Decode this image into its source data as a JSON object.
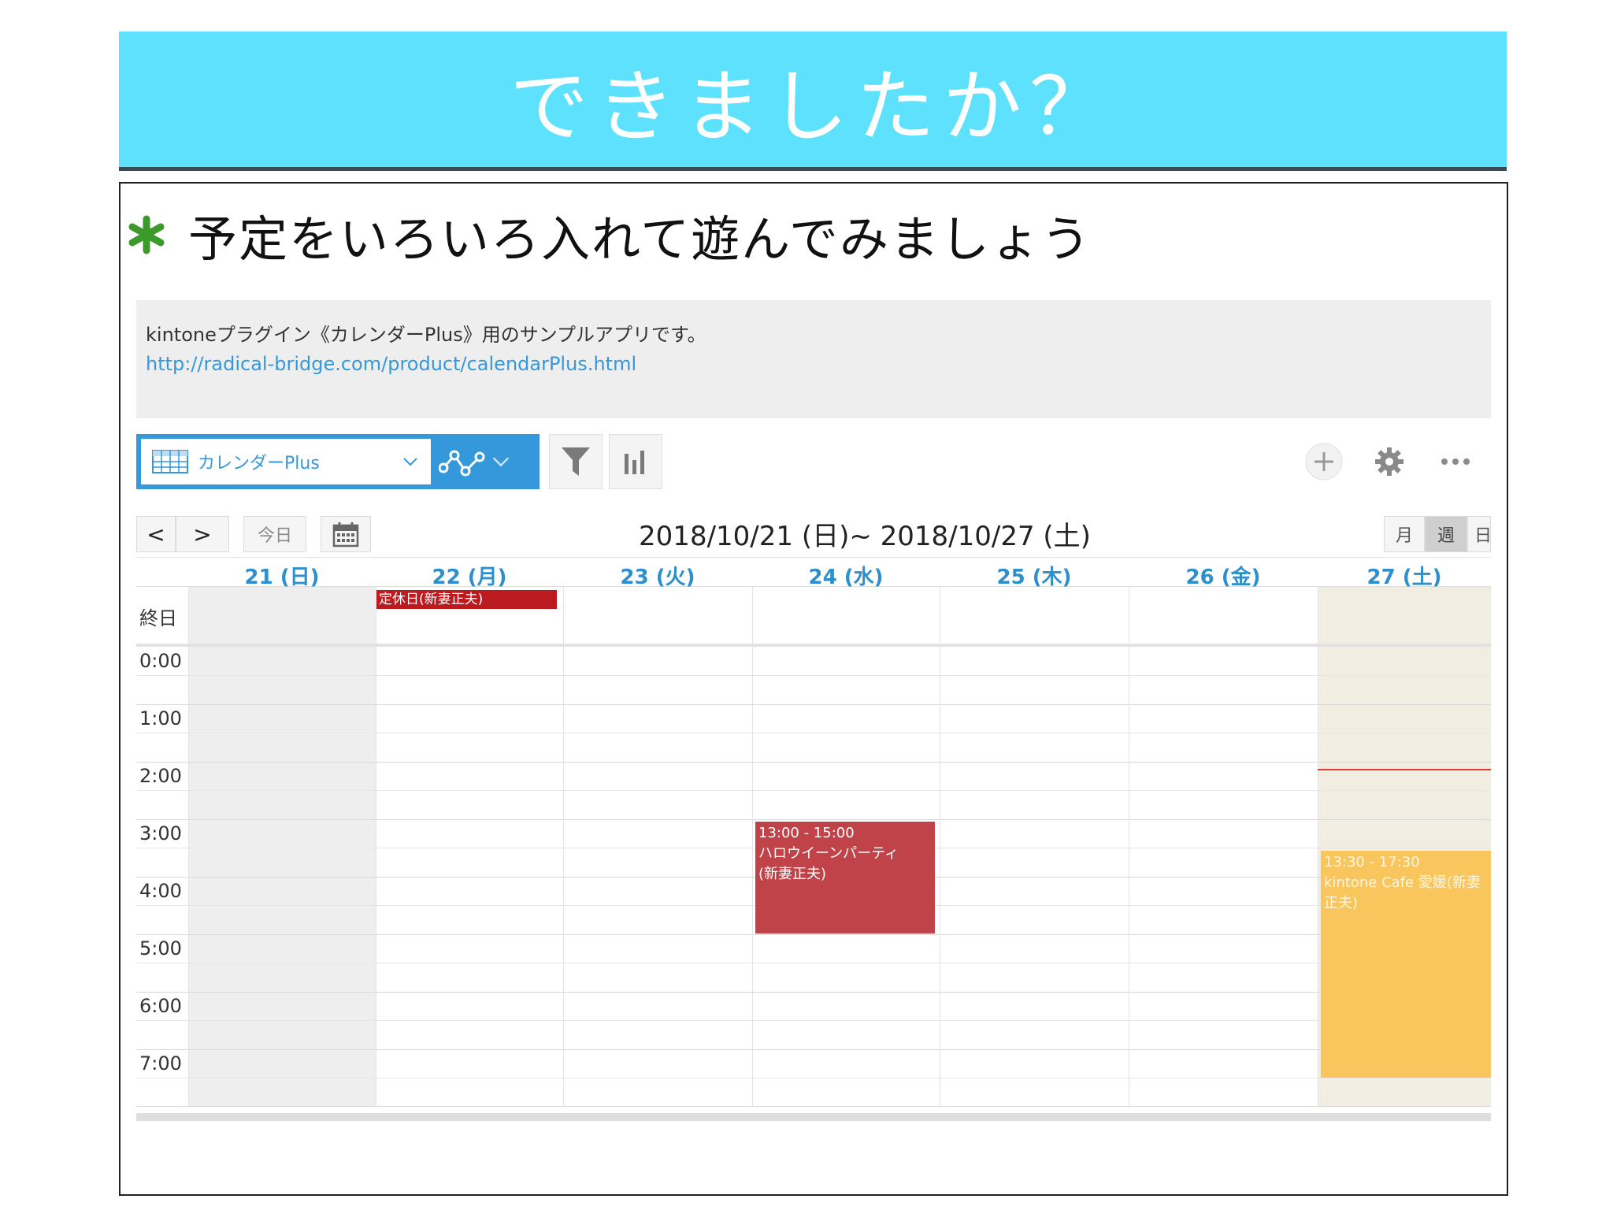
{
  "slide": {
    "title": "できましたか？",
    "bullet_text": "予定をいろいろ入れて遊んでみましょう",
    "accent_color": "#5de1fc",
    "bullet_color": "#3c9a2b"
  },
  "app": {
    "description": "kintoneプラグイン《カレンダーPlus》用のサンプルアプリです。",
    "link": "http://radical-bridge.com/product/calendarPlus.html",
    "view_label": "カレンダーPlus",
    "icons": {
      "view": "table-grid-icon",
      "graph": "line-graph-icon",
      "filter": "funnel-icon",
      "chart": "bar-chart-icon",
      "add": "plus-icon",
      "settings": "gear-icon",
      "more": "ellipsis-icon"
    }
  },
  "calendar": {
    "prev": "<",
    "next": ">",
    "today": "今日",
    "range": "2018/10/21 (日)~ 2018/10/27 (土)",
    "views": [
      "月",
      "週",
      "日"
    ],
    "allday_label": "終日",
    "days": [
      "21 (日)",
      "22 (月)",
      "23 (火)",
      "24 (水)",
      "25 (木)",
      "26 (金)",
      "27 (土)"
    ],
    "times": [
      "0:00",
      "1:00",
      "2:00",
      "3:00",
      "4:00",
      "5:00",
      "6:00",
      "7:00"
    ],
    "allday_event": "定休日(新妻正夫)",
    "events": [
      {
        "time": "13:00 - 15:00",
        "title": "ハロウイーンパーティ",
        "who": "(新妻正夫)",
        "color": "#c0434a"
      },
      {
        "time": "13:30 - 17:30",
        "title": "kintone Cafe 愛媛(新妻",
        "who": "正夫)",
        "color": "#f9c65e"
      }
    ]
  }
}
